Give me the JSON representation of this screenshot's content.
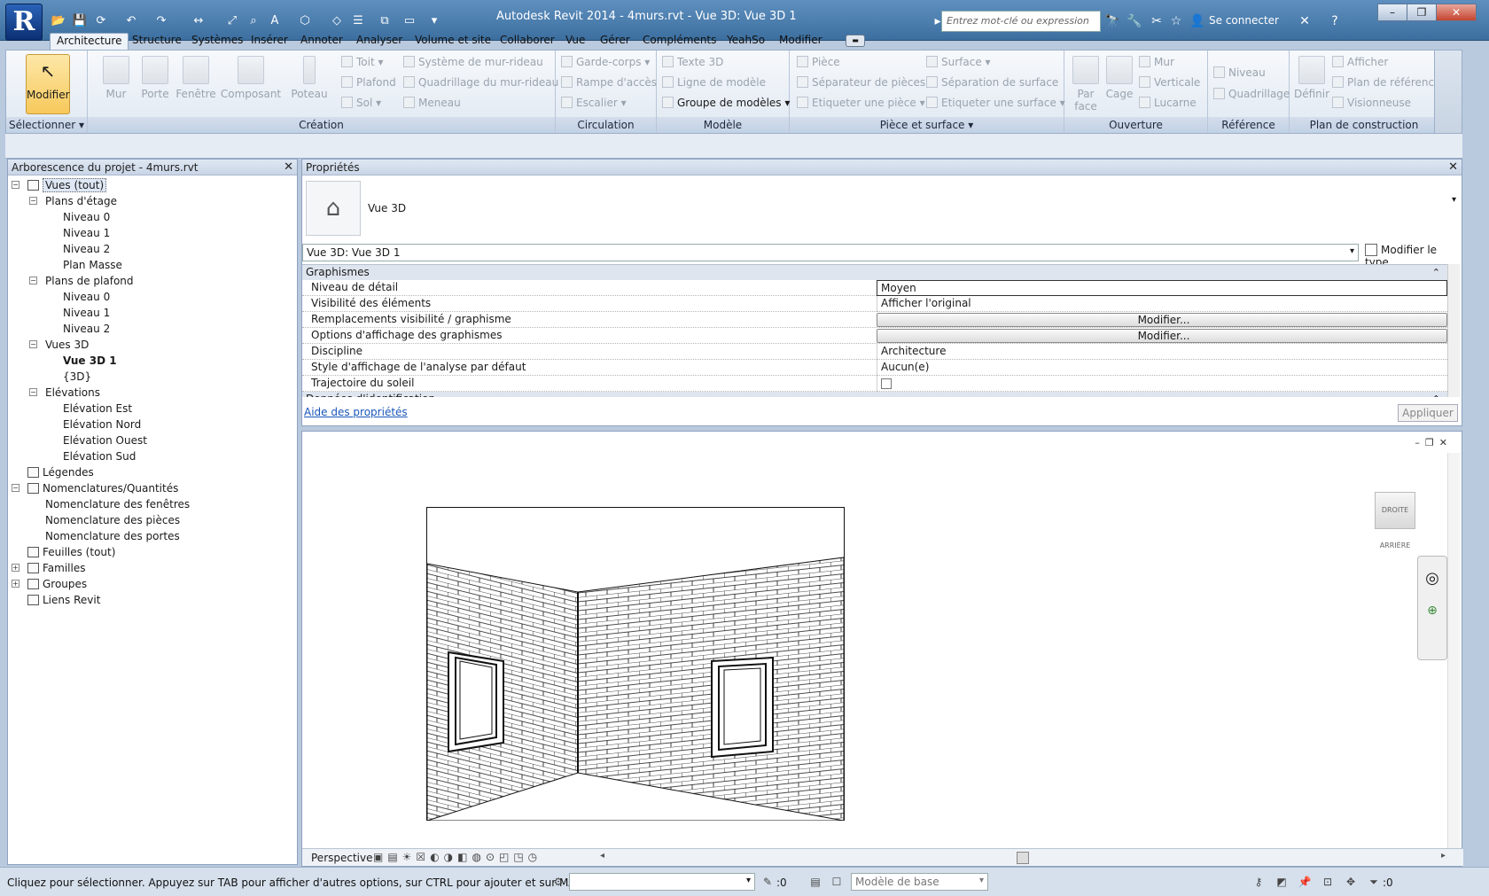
{
  "window": {
    "title": "Autodesk Revit 2014 -     4murs.rvt - Vue 3D: Vue 3D 1",
    "app_letter": "R",
    "search_placeholder": "Entrez mot-clé ou expression",
    "sign_in": "Se connecter"
  },
  "tabs": [
    "Architecture",
    "Structure",
    "Systèmes",
    "Insérer",
    "Annoter",
    "Analyser",
    "Volume et site",
    "Collaborer",
    "Vue",
    "Gérer",
    "Compléments",
    "YeahSo",
    "Modifier"
  ],
  "ribbon": {
    "select_panel": {
      "button": "Modifier",
      "title": "Sélectionner ▾"
    },
    "creation": {
      "title": "Création",
      "big": [
        "Mur",
        "Porte",
        "Fenêtre",
        "Composant",
        "Poteau"
      ],
      "small": [
        "Toit ▾",
        "Plafond",
        "Sol ▾",
        "Système de mur-rideau",
        "Quadrillage du mur-rideau",
        "Meneau"
      ]
    },
    "circulation": {
      "title": "Circulation",
      "small": [
        "Garde-corps ▾",
        "Rampe d'accès",
        "Escalier ▾"
      ]
    },
    "model": {
      "title": "Modèle",
      "small": [
        "Texte 3D",
        "Ligne de modèle",
        "Groupe de modèles ▾"
      ]
    },
    "room": {
      "title": "Pièce et surface ▾",
      "small": [
        "Pièce",
        "Séparateur de pièces",
        "Etiqueter une pièce ▾",
        "Surface ▾",
        "Séparation de surface",
        "Etiqueter une surface ▾"
      ]
    },
    "opening": {
      "title": "Ouverture",
      "big": [
        "Par face",
        "Cage"
      ],
      "small": [
        "Mur",
        "Verticale",
        "Lucarne"
      ]
    },
    "reference": {
      "title": "Référence",
      "small": [
        "Niveau",
        "Quadrillage"
      ]
    },
    "workplane": {
      "title": "Plan de construction",
      "big": [
        "Définir"
      ],
      "small": [
        "Afficher",
        "Plan de référence",
        "Visionneuse"
      ]
    }
  },
  "browser": {
    "title": "Arborescence du projet - 4murs.rvt",
    "nodes": [
      {
        "label": "Vues (tout)",
        "level": 0,
        "exp": "-"
      },
      {
        "label": "Plans d'étage",
        "level": 1,
        "exp": "-"
      },
      {
        "label": "Niveau 0",
        "level": 2
      },
      {
        "label": "Niveau 1",
        "level": 2
      },
      {
        "label": "Niveau 2",
        "level": 2
      },
      {
        "label": "Plan Masse",
        "level": 2
      },
      {
        "label": "Plans de plafond",
        "level": 1,
        "exp": "-"
      },
      {
        "label": "Niveau 0",
        "level": 2
      },
      {
        "label": "Niveau 1",
        "level": 2
      },
      {
        "label": "Niveau 2",
        "level": 2
      },
      {
        "label": "Vues 3D",
        "level": 1,
        "exp": "-"
      },
      {
        "label": "Vue 3D 1",
        "level": 2,
        "bold": true
      },
      {
        "label": "{3D}",
        "level": 2
      },
      {
        "label": "Elévations",
        "level": 1,
        "exp": "-"
      },
      {
        "label": "Elévation Est",
        "level": 2
      },
      {
        "label": "Elévation Nord",
        "level": 2
      },
      {
        "label": "Elévation Ouest",
        "level": 2
      },
      {
        "label": "Elévation Sud",
        "level": 2
      },
      {
        "label": "Légendes",
        "level": 0,
        "icon": true
      },
      {
        "label": "Nomenclatures/Quantités",
        "level": 0,
        "exp": "-",
        "icon": true
      },
      {
        "label": "Nomenclature des fenêtres",
        "level": 1
      },
      {
        "label": "Nomenclature des pièces",
        "level": 1
      },
      {
        "label": "Nomenclature des portes",
        "level": 1
      },
      {
        "label": "Feuilles (tout)",
        "level": 0,
        "icon": true
      },
      {
        "label": "Familles",
        "level": 0,
        "exp": "+",
        "icon": true
      },
      {
        "label": "Groupes",
        "level": 0,
        "exp": "+",
        "icon": true
      },
      {
        "label": "Liens Revit",
        "level": 0,
        "icon": true
      }
    ]
  },
  "properties": {
    "title": "Propriétés",
    "type_name": "Vue 3D",
    "instance_select": "Vue 3D: Vue 3D 1",
    "edit_type": "Modifier le type",
    "groups": [
      {
        "name": "Graphismes",
        "rows": [
          {
            "name": "Niveau de détail",
            "value": "Moyen"
          },
          {
            "name": "Visibilité des éléments",
            "value": "Afficher l'original"
          },
          {
            "name": "Remplacements visibilité / graphisme",
            "value": "Modifier...",
            "button": true
          },
          {
            "name": "Options d'affichage des graphismes",
            "value": "Modifier...",
            "button": true
          },
          {
            "name": "Discipline",
            "value": "Architecture"
          },
          {
            "name": "Style d'affichage de l'analyse par défaut",
            "value": "Aucun(e)"
          },
          {
            "name": "Trajectoire du soleil",
            "value": "",
            "checkbox": true
          }
        ]
      },
      {
        "name": "Données d'identification",
        "rows": []
      }
    ],
    "help_link": "Aide des propriétés",
    "apply": "Appliquer"
  },
  "view": {
    "viewcube_left": "DROITE",
    "viewcube_right": "ARRIÈRE",
    "control_label": "Perspective"
  },
  "statusbar": {
    "message": "Cliquez pour sélectionner. Appuyez sur TAB pour afficher d'autres options, sur CTRL pour ajouter et sur MAJ pour c",
    "selection_count": ":0",
    "design_option": "Modèle de base",
    "filter_count": ":0"
  }
}
